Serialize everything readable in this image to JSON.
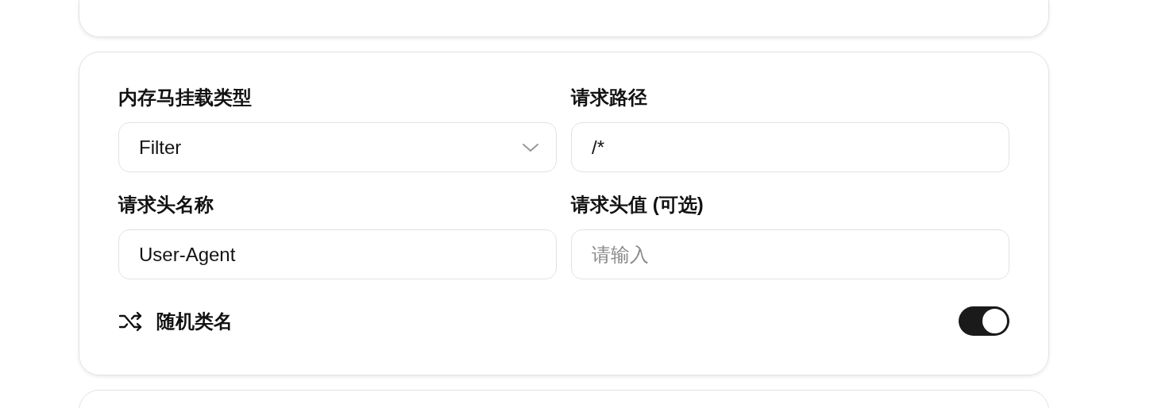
{
  "form": {
    "fields": [
      {
        "kind": "select",
        "label": "内存马挂载类型",
        "value": "Filter"
      },
      {
        "kind": "input",
        "label": "请求路径",
        "value": "/*"
      },
      {
        "kind": "input",
        "label": "请求头名称",
        "value": "User-Agent"
      },
      {
        "kind": "input",
        "label": "请求头值 (可选)",
        "placeholder": "请输入"
      }
    ],
    "toggle": {
      "label": "随机类名",
      "on": true
    }
  }
}
